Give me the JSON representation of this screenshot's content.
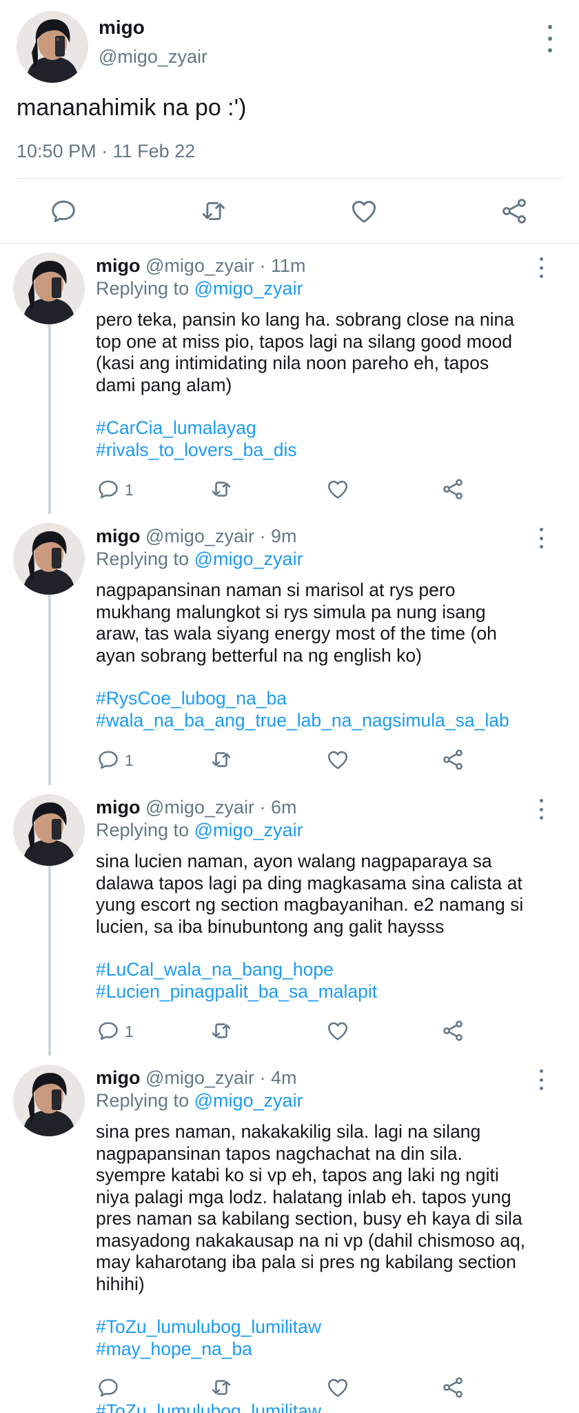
{
  "main_tweet": {
    "name": "migo",
    "handle": "@migo_zyair",
    "text": "mananahimik na po :')",
    "timestamp": "10:50 PM · 11 Feb 22"
  },
  "replies": [
    {
      "name": "migo",
      "handle": "@migo_zyair",
      "time": "11m",
      "replying_prefix": "Replying to",
      "replying_to": "@migo_zyair",
      "lines": [
        "pero teka, pansin ko lang ha. sobrang close na nina",
        "top one at miss pio, tapos lagi na silang good mood",
        "(kasi ang intimidating nila noon pareho eh, tapos",
        "dami pang alam)"
      ],
      "hashtags": [
        "#CarCia_lumalayag",
        "#rivals_to_lovers_ba_dis"
      ],
      "reply_count": "1"
    },
    {
      "name": "migo",
      "handle": "@migo_zyair",
      "time": "9m",
      "replying_prefix": "Replying to",
      "replying_to": "@migo_zyair",
      "lines": [
        "nagpapansinan naman si marisol at rys pero",
        "mukhang malungkot si rys simula pa nung isang",
        "araw, tas wala siyang energy most of the time (oh",
        "ayan sobrang betterful na ng english ko)"
      ],
      "hashtags": [
        "#RysCoe_lubog_na_ba",
        "#wala_na_ba_ang_true_lab_na_nagsimula_sa_lab"
      ],
      "reply_count": "1"
    },
    {
      "name": "migo",
      "handle": "@migo_zyair",
      "time": "6m",
      "replying_prefix": "Replying to",
      "replying_to": "@migo_zyair",
      "lines": [
        "sina lucien naman, ayon walang nagpaparaya sa",
        "dalawa tapos lagi pa ding magkasama sina calista at",
        "yung escort ng section magbayanihan. e2 namang si",
        "lucien, sa iba binubuntong ang galit haysss"
      ],
      "hashtags": [
        "#LuCal_wala_na_bang_hope",
        "#Lucien_pinagpalit_ba_sa_malapit"
      ],
      "reply_count": "1"
    },
    {
      "name": "migo",
      "handle": "@migo_zyair",
      "time": "4m",
      "replying_prefix": "Replying to",
      "replying_to": "@migo_zyair",
      "lines": [
        "sina pres naman, nakakakilig sila. lagi na silang",
        "nagpapansinan tapos nagchachat na din sila.",
        "syempre katabi ko si vp eh, tapos ang laki ng ngiti",
        "niya palagi mga lodz. halatang inlab eh. tapos yung",
        "pres naman sa kabilang section, busy eh kaya di sila",
        "masyadong nakakausap na ni vp (dahil chismoso aq,",
        "may kaharotang iba pala si pres ng kabilang section",
        "hihihi)"
      ],
      "hashtags": [
        "#ToZu_lumulubog_lumilitaw",
        "#may_hope_na_ba"
      ],
      "reply_count": ""
    }
  ],
  "cut_off_text": "#ToZu_lumulubog_lumilitaw",
  "colors": {
    "link": "#1d9bf0",
    "secondary": "#657786",
    "divider": "#dfe3e6"
  },
  "icons": {
    "avatar": "selfie-avatar",
    "more": "more-vertical-icon",
    "reply": "reply-icon",
    "retweet": "retweet-icon",
    "like": "heart-icon",
    "share": "share-icon"
  }
}
